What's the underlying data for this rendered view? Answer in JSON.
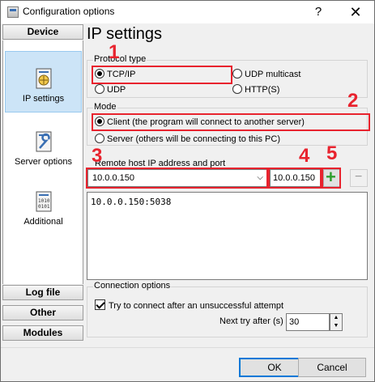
{
  "window": {
    "title": "Configuration options",
    "help_glyph": "?",
    "close_glyph": "✕"
  },
  "sidebar": {
    "top_section": "Device",
    "items": [
      {
        "label": "IP settings",
        "icon": "network-config-icon",
        "selected": true
      },
      {
        "label": "Server options",
        "icon": "wrench-document-icon",
        "selected": false
      },
      {
        "label": "Additional",
        "icon": "binary-document-icon",
        "selected": false
      }
    ],
    "bottom_sections": [
      "Log file",
      "Other",
      "Modules"
    ]
  },
  "main": {
    "heading": "IP settings",
    "protocol_type": {
      "title": "Protocol type",
      "options": [
        {
          "label": "TCP/IP",
          "selected": true
        },
        {
          "label": "UDP multicast",
          "selected": false
        },
        {
          "label": "UDP",
          "selected": false
        },
        {
          "label": "HTTP(S)",
          "selected": false
        }
      ]
    },
    "mode": {
      "title": "Mode",
      "options": [
        {
          "label": "Client (the program will connect to another server)",
          "selected": true
        },
        {
          "label": "Server (others will be connecting to this PC)",
          "selected": false
        }
      ]
    },
    "remote_host": {
      "label": "Remote host IP address and port",
      "host_value": "10.0.0.150",
      "port_value": "10.0.0.150",
      "add_glyph": "+",
      "remove_glyph": "−"
    },
    "host_list": [
      "10.0.0.150:5038"
    ],
    "connection_options": {
      "title": "Connection options",
      "retry_label": "Try to connect after an unsuccessful attempt",
      "retry_checked": true,
      "next_try_label": "Next try after (s)",
      "next_try_value": "30"
    }
  },
  "annotations": [
    "1",
    "2",
    "3",
    "4",
    "5"
  ],
  "footer": {
    "ok_label": "OK",
    "cancel_label": "Cancel"
  },
  "colors": {
    "annotation_red": "#e8232e",
    "selection_blue": "#cce4f7",
    "add_green": "#2e9e2e"
  }
}
